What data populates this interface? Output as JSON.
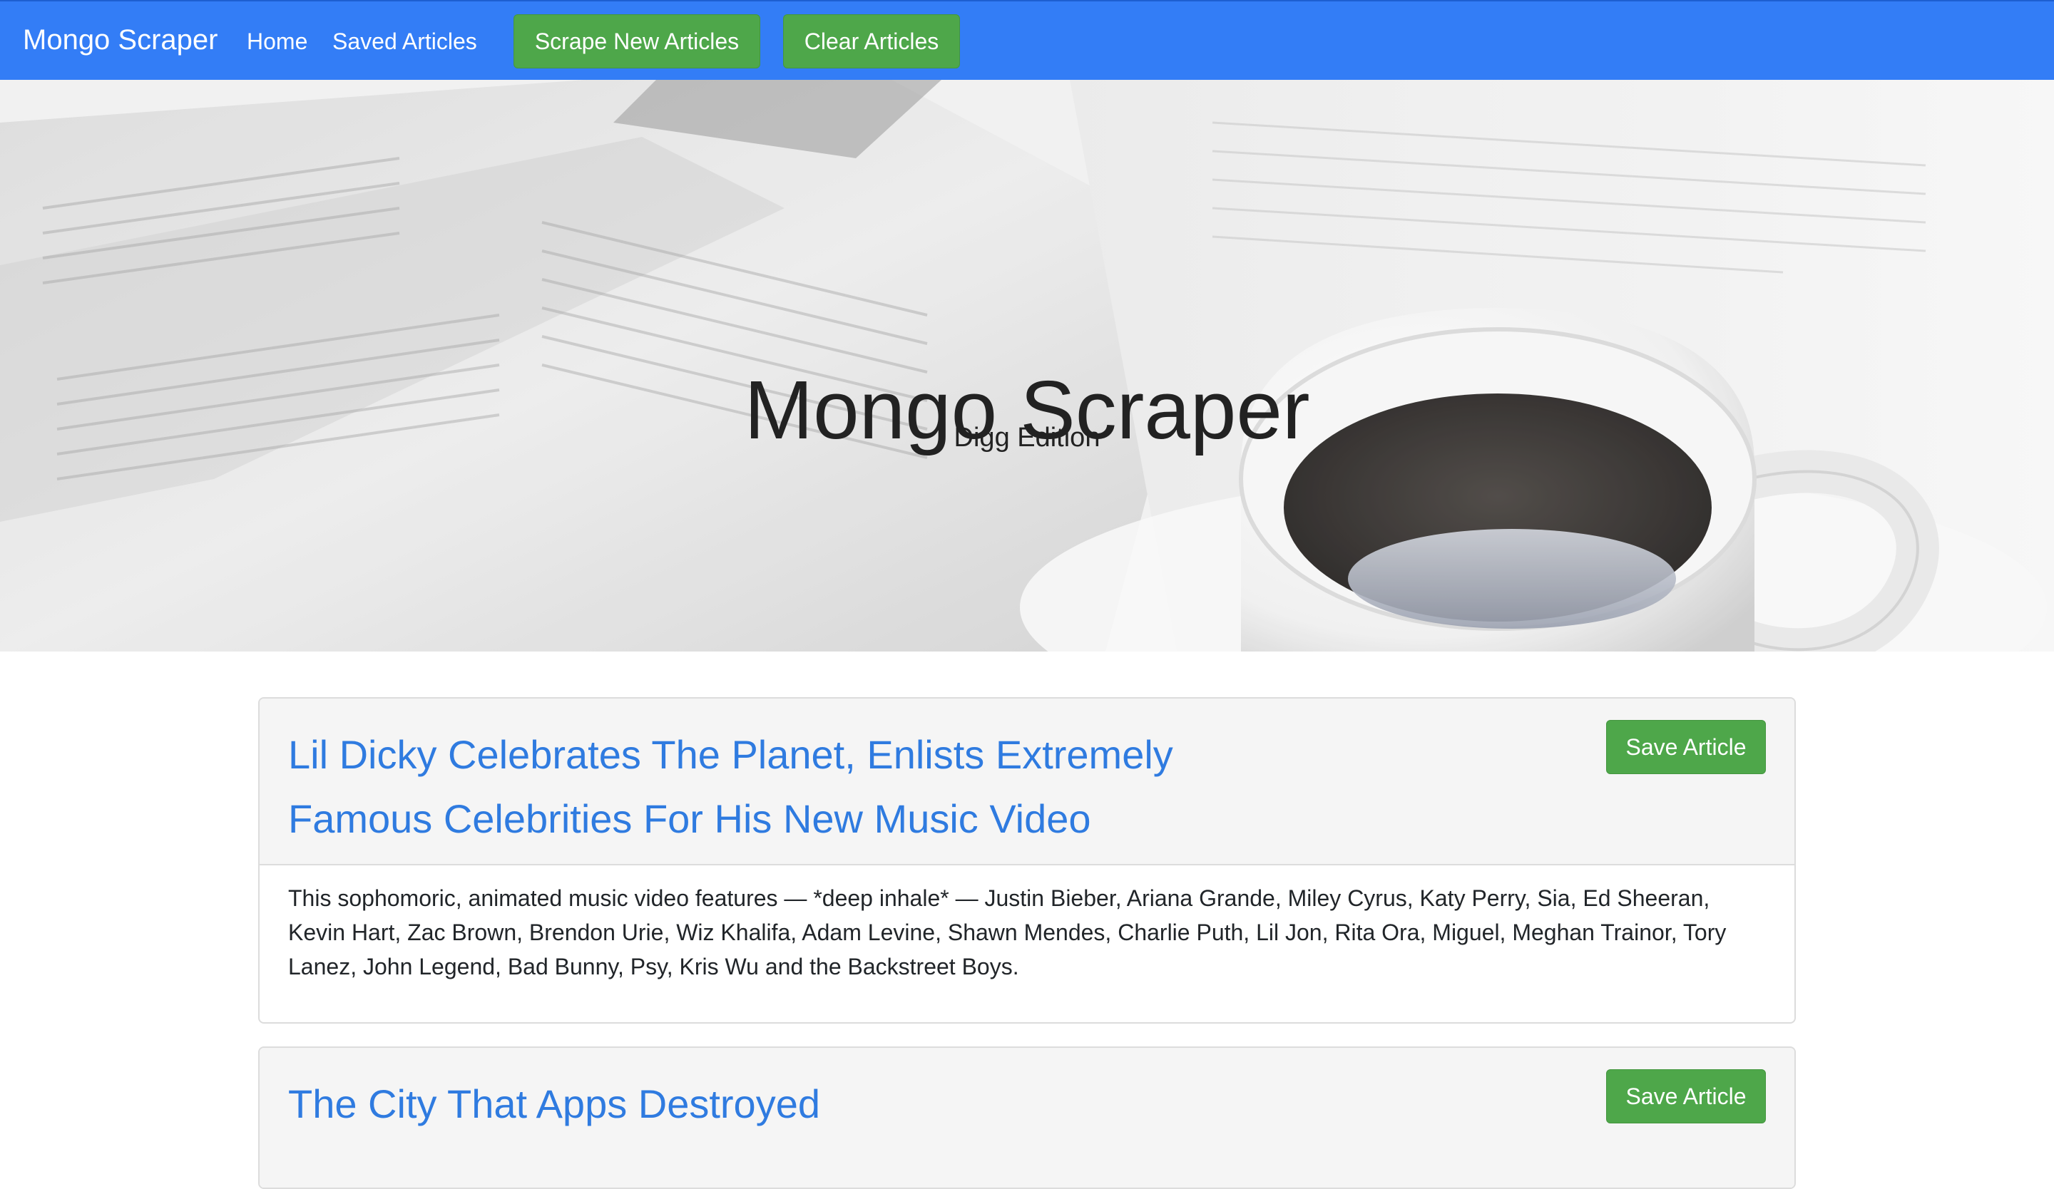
{
  "navbar": {
    "brand": "Mongo Scraper",
    "links": {
      "home": "Home",
      "saved": "Saved Articles"
    },
    "buttons": {
      "scrape": "Scrape New Articles",
      "clear": "Clear Articles"
    }
  },
  "hero": {
    "title": "Mongo Scraper",
    "subtitle": "Digg Edition",
    "background_icon": "newspaper-and-coffee-image"
  },
  "articles": [
    {
      "title": "Lil Dicky Celebrates The Planet, Enlists Extremely Famous Celebrities For His New Music Video",
      "summary": "This sophomoric, animated music video features — *deep inhale* — Justin Bieber, Ariana Grande, Miley Cyrus, Katy Perry, Sia, Ed Sheeran, Kevin Hart, Zac Brown, Brendon Urie, Wiz Khalifa, Adam Levine, Shawn Mendes, Charlie Puth, Lil Jon, Rita Ora, Miguel, Meghan Trainor, Tory Lanez, John Legend, Bad Bunny, Psy, Kris Wu and the Backstreet Boys.",
      "save_label": "Save Article"
    },
    {
      "title": "The City That Apps Destroyed",
      "save_label": "Save Article"
    }
  ],
  "colors": {
    "navbar": "#337df6",
    "button_green": "#4ea74a",
    "link_blue": "#2f7be0"
  }
}
